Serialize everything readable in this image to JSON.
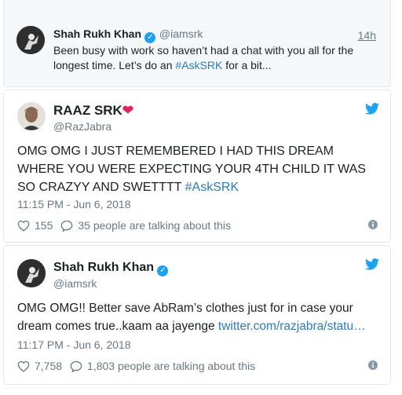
{
  "parent_tweet": {
    "name": "Shah Rukh Khan",
    "handle": "@iamsrk",
    "time": "14h",
    "text_before": "Been busy with work so haven’t had a chat with you all for the longest time. Let’s do an ",
    "hashtag": "#AskSRK",
    "text_after": " for a bit..."
  },
  "tweet1": {
    "name": "RAAZ SRK",
    "heart": "❤",
    "handle": "@RazJabra",
    "text": "OMG OMG I JUST REMEMBERED I HAD THIS DREAM WHERE YOU WERE EXPECTING YOUR 4TH CHILD IT WAS SO CRAZYY AND SWETTTT ",
    "hashtag": "#AskSRK",
    "timestamp": "11:15 PM - Jun 6, 2018",
    "likes": "155",
    "replies": "35 people are talking about this"
  },
  "tweet2": {
    "name": "Shah Rukh Khan",
    "handle": "@iamsrk",
    "text": "OMG OMG!! Better save AbRam’s clothes just for in case your dream comes true..kaam aa jayenge ",
    "link": "twitter.com/razjabra/statu…",
    "timestamp": "11:17 PM - Jun 6, 2018",
    "likes": "7,758",
    "replies": "1,803 people are talking about this"
  },
  "colors": {
    "twitter_blue": "#1da1f2",
    "link_blue": "#2b7bb9",
    "heart_red": "#e0245e",
    "gray": "#697882",
    "border": "#e1e8ed"
  },
  "icons": [
    "twitter-bird-icon",
    "verified-badge-icon",
    "heart-icon",
    "reply-icon",
    "info-icon"
  ]
}
